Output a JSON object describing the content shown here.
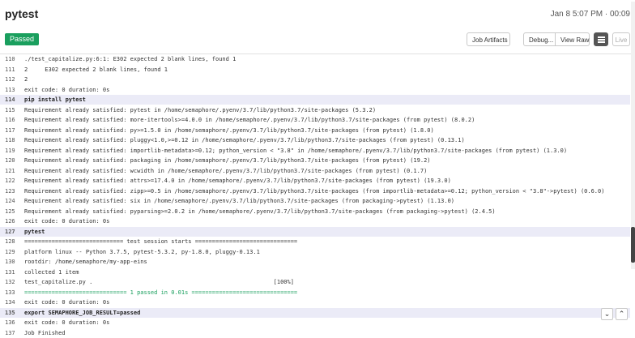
{
  "header": {
    "title": "pytest",
    "timestamp": "Jan 8 5:07 PM · 00:09"
  },
  "toolbar": {
    "status_badge": "Passed",
    "artifacts_label": "Job Artifacts",
    "debug_label": "Debug...",
    "view_raw_label": "View Raw",
    "live_label": "Live"
  },
  "log": {
    "lines": [
      {
        "n": "110",
        "t": "./test_capitalize.py:6:1: E302 expected 2 blank lines, found 1",
        "kind": ""
      },
      {
        "n": "111",
        "t": "2     E302 expected 2 blank lines, found 1",
        "kind": ""
      },
      {
        "n": "112",
        "t": "2",
        "kind": ""
      },
      {
        "n": "113",
        "t": "exit code: 0 duration: 0s",
        "kind": ""
      },
      {
        "n": "114",
        "t": "pip install pytest",
        "kind": "cmd"
      },
      {
        "n": "115",
        "t": "Requirement already satisfied: pytest in /home/semaphore/.pyenv/3.7/lib/python3.7/site-packages (5.3.2)",
        "kind": ""
      },
      {
        "n": "116",
        "t": "Requirement already satisfied: more-itertools>=4.0.0 in /home/semaphore/.pyenv/3.7/lib/python3.7/site-packages (from pytest) (8.0.2)",
        "kind": ""
      },
      {
        "n": "117",
        "t": "Requirement already satisfied: py>=1.5.0 in /home/semaphore/.pyenv/3.7/lib/python3.7/site-packages (from pytest) (1.8.0)",
        "kind": ""
      },
      {
        "n": "118",
        "t": "Requirement already satisfied: pluggy<1.0,>=0.12 in /home/semaphore/.pyenv/3.7/lib/python3.7/site-packages (from pytest) (0.13.1)",
        "kind": ""
      },
      {
        "n": "119",
        "t": "Requirement already satisfied: importlib-metadata>=0.12; python_version < \"3.8\" in /home/semaphore/.pyenv/3.7/lib/python3.7/site-packages (from pytest) (1.3.0)",
        "kind": ""
      },
      {
        "n": "120",
        "t": "Requirement already satisfied: packaging in /home/semaphore/.pyenv/3.7/lib/python3.7/site-packages (from pytest) (19.2)",
        "kind": ""
      },
      {
        "n": "121",
        "t": "Requirement already satisfied: wcwidth in /home/semaphore/.pyenv/3.7/lib/python3.7/site-packages (from pytest) (0.1.7)",
        "kind": ""
      },
      {
        "n": "122",
        "t": "Requirement already satisfied: attrs>=17.4.0 in /home/semaphore/.pyenv/3.7/lib/python3.7/site-packages (from pytest) (19.3.0)",
        "kind": ""
      },
      {
        "n": "123",
        "t": "Requirement already satisfied: zipp>=0.5 in /home/semaphore/.pyenv/3.7/lib/python3.7/site-packages (from importlib-metadata>=0.12; python_version < \"3.8\"->pytest) (0.6.0)",
        "kind": ""
      },
      {
        "n": "124",
        "t": "Requirement already satisfied: six in /home/semaphore/.pyenv/3.7/lib/python3.7/site-packages (from packaging->pytest) (1.13.0)",
        "kind": ""
      },
      {
        "n": "125",
        "t": "Requirement already satisfied: pyparsing>=2.0.2 in /home/semaphore/.pyenv/3.7/lib/python3.7/site-packages (from packaging->pytest) (2.4.5)",
        "kind": ""
      },
      {
        "n": "126",
        "t": "exit code: 0 duration: 0s",
        "kind": ""
      },
      {
        "n": "127",
        "t": "pytest",
        "kind": "cmd"
      },
      {
        "n": "128",
        "t": "============================= test session starts ==============================",
        "kind": ""
      },
      {
        "n": "129",
        "t": "platform linux -- Python 3.7.5, pytest-5.3.2, py-1.8.0, pluggy-0.13.1",
        "kind": ""
      },
      {
        "n": "130",
        "t": "rootdir: /home/semaphore/my-app-eins",
        "kind": ""
      },
      {
        "n": "131",
        "t": "collected 1 item",
        "kind": ""
      },
      {
        "n": "132",
        "t": "test_capitalize.py .                                                     [100%]",
        "kind": ""
      },
      {
        "n": "133",
        "t": "============================== 1 passed in 0.01s ===============================",
        "kind": "green"
      },
      {
        "n": "134",
        "t": "exit code: 0 duration: 0s",
        "kind": ""
      },
      {
        "n": "135",
        "t": "export SEMAPHORE_JOB_RESULT=passed",
        "kind": "cmd"
      },
      {
        "n": "136",
        "t": "exit code: 0 duration: 0s",
        "kind": ""
      },
      {
        "n": "137",
        "t": "Job Finished",
        "kind": ""
      }
    ]
  },
  "icons": {
    "menu": "hamburger-icon",
    "scroll_down": "chevron-down-icon",
    "scroll_up": "chevron-up-icon"
  },
  "colors": {
    "passed": "#1a9f5e",
    "command_highlight": "#ebebf7",
    "menu_button": "#555555"
  }
}
